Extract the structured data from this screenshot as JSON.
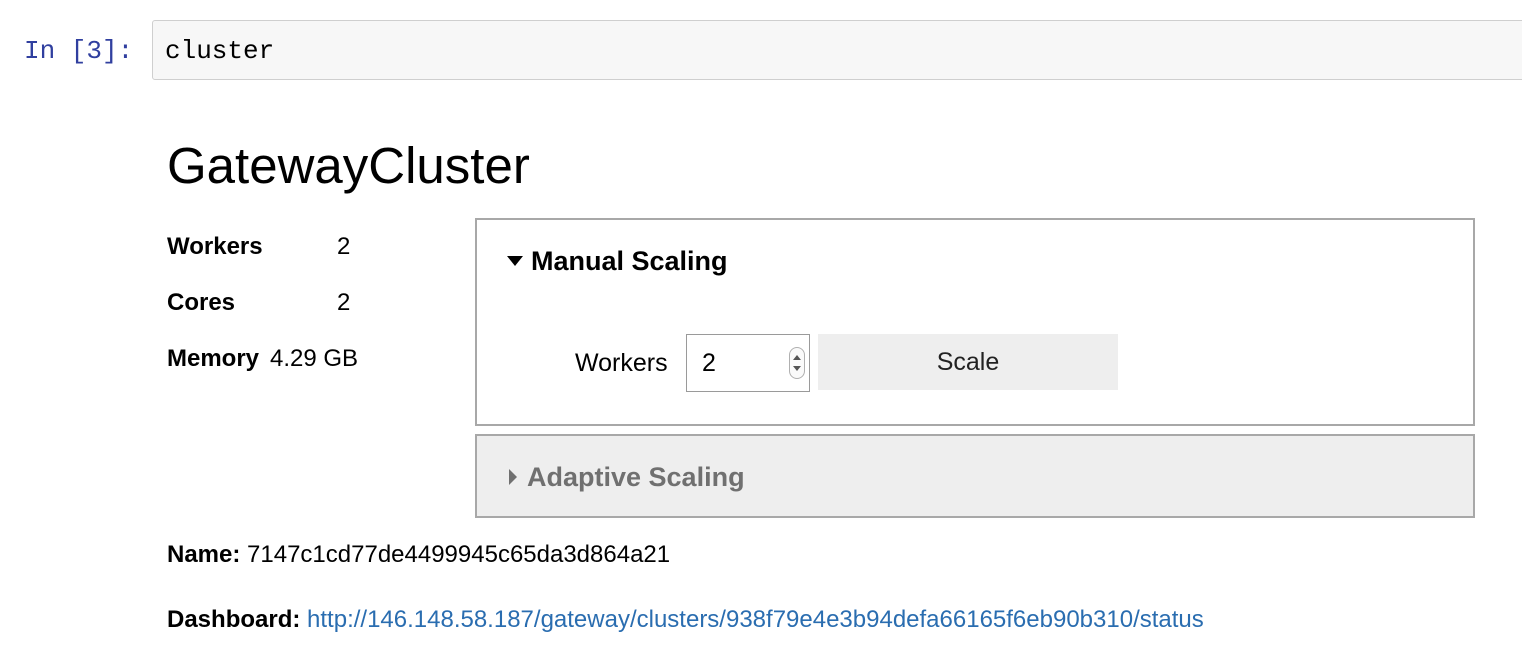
{
  "cell": {
    "prompt": "In [3]:",
    "code": "cluster"
  },
  "output": {
    "title": "GatewayCluster",
    "stats": [
      {
        "label": "Workers",
        "value": "2"
      },
      {
        "label": "Cores",
        "value": "2"
      },
      {
        "label": "Memory",
        "value": "4.29 GB"
      }
    ],
    "manual_scaling": {
      "header": "Manual Scaling",
      "expanded": true,
      "workers_label": "Workers",
      "workers_value": "2",
      "scale_button": "Scale"
    },
    "adaptive_scaling": {
      "header": "Adaptive Scaling",
      "expanded": false
    },
    "name_label": "Name:",
    "name_value": "7147c1cd77de4499945c65da3d864a21",
    "dashboard_label": "Dashboard:",
    "dashboard_url": "http://146.148.58.187/gateway/clusters/938f79e4e3b94defa66165f6eb90b310/status"
  },
  "colors": {
    "prompt": "#303F9F",
    "link": "#2a6db0",
    "code_background": "#f7f7f7",
    "collapsed_panel_background": "#eeeeee",
    "button_background": "#eeeeee"
  },
  "icons": {
    "expanded": "caret-down-icon",
    "collapsed": "caret-right-icon",
    "spinner": "spinner-arrows-icon"
  }
}
